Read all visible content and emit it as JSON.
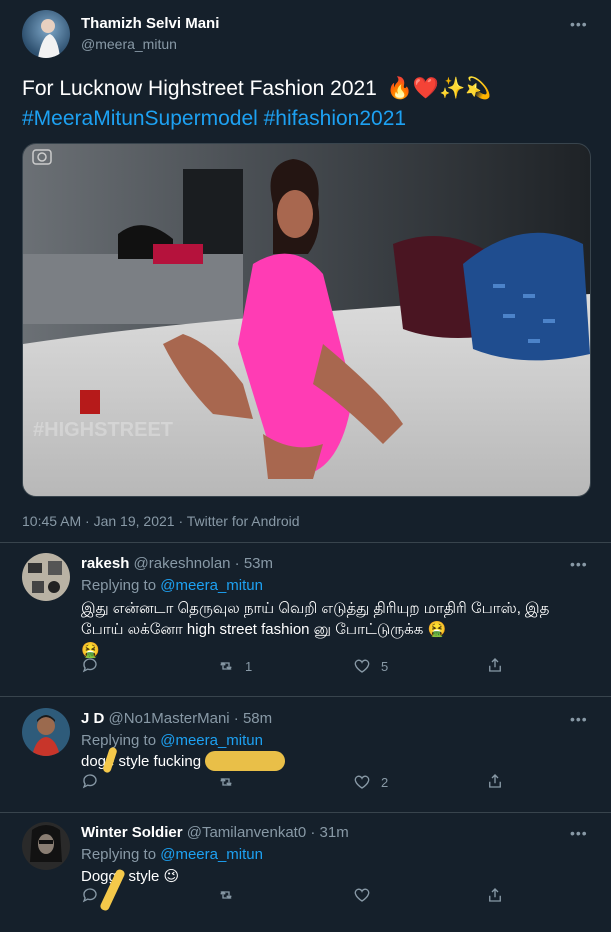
{
  "author": {
    "name": "Thamizh Selvi Mani",
    "handle": "@meera_mitun"
  },
  "tweet": {
    "text": "For Lucknow Highstreet Fashion 2021",
    "emojis": "🔥❤️✨💫",
    "hashtags": "#MeeraMitunSupermodel #hifashion2021",
    "image_watermark": "#HIGHSTREET",
    "meta": "10:45 AM · Jan 19, 2021 · Twitter for Android"
  },
  "more_label": "•••",
  "replies": [
    {
      "name": "rakesh",
      "handle": "@rakeshnolan",
      "time": "· 53m",
      "replying_prefix": "Replying to",
      "replying_to": "@meera_mitun",
      "text": "இது என்னடா தெருவுல நாய் வெறி எடுத்து திரியுற மாதிரி போஸ், இத போய் லக்னோ high street fashion னு போட்டுருக்க",
      "emoji": "🤮",
      "emoji2": "🤮",
      "retweets": "1",
      "likes": "5"
    },
    {
      "name": "J D",
      "handle": "@No1MasterMani",
      "time": "· 58m",
      "replying_prefix": "Replying to",
      "replying_to": "@meera_mitun",
      "text": "doge style fucking",
      "retweets": "",
      "likes": "2"
    },
    {
      "name": "Winter Soldier",
      "handle": "@Tamilanvenkat0",
      "time": "· 31m",
      "replying_prefix": "Replying to",
      "replying_to": "@meera_mitun",
      "text": "Doggy style",
      "emoji": "😉",
      "retweets": "",
      "likes": ""
    }
  ],
  "colors": {
    "background": "#15202b",
    "link": "#1da1f2",
    "muted": "#8899a6",
    "divider": "#38444d",
    "dress": "#ff3cb4"
  }
}
